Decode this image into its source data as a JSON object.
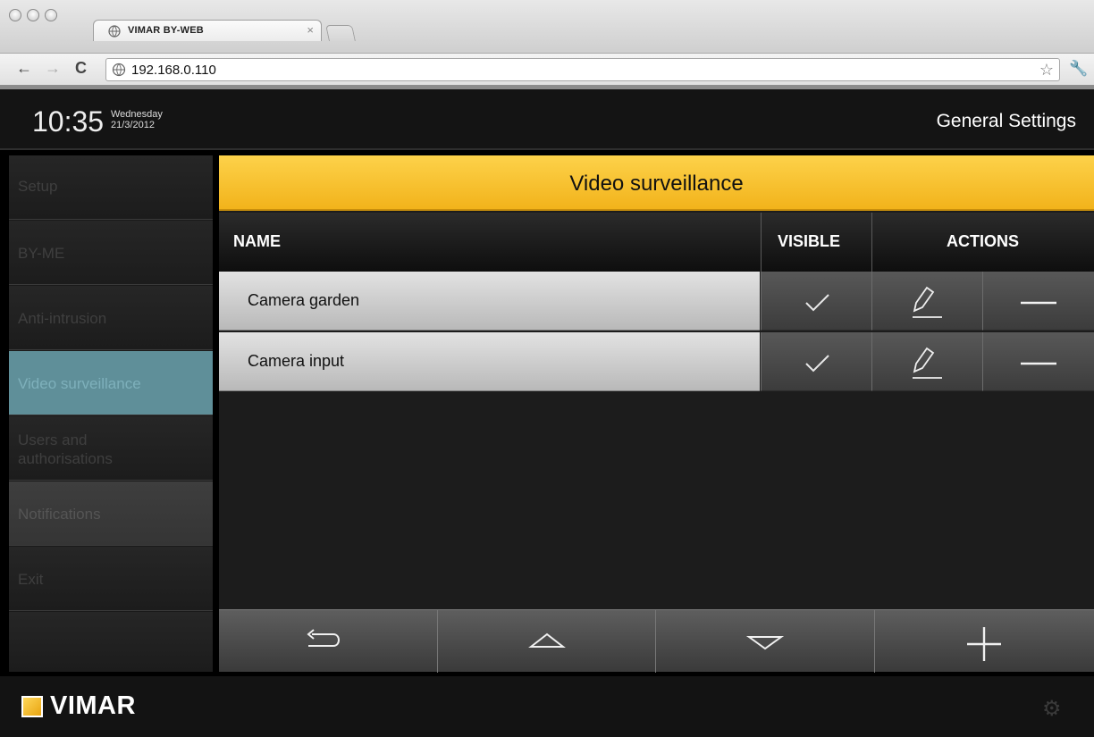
{
  "browser": {
    "tab_title": "VIMAR BY-WEB",
    "url": "192.168.0.110"
  },
  "header": {
    "time": "10:35",
    "weekday": "Wednesday",
    "date": "21/3/2012",
    "title": "General Settings"
  },
  "sidebar": {
    "items": [
      {
        "label": "Setup",
        "state": "normal"
      },
      {
        "label": "BY-ME",
        "state": "normal"
      },
      {
        "label": "Anti-intrusion",
        "state": "normal"
      },
      {
        "label": "Video surveillance",
        "state": "active"
      },
      {
        "label": "Users and authorisations",
        "state": "normal"
      },
      {
        "label": "Notifications",
        "state": "dim"
      },
      {
        "label": "Exit",
        "state": "normal"
      }
    ]
  },
  "main": {
    "section_title": "Video surveillance",
    "columns": {
      "name": "NAME",
      "visible": "VISIBLE",
      "actions": "ACTIONS"
    },
    "rows": [
      {
        "name": "Camera garden",
        "visible": true
      },
      {
        "name": "Camera input",
        "visible": true
      }
    ]
  },
  "bottom_buttons": [
    "back-arrow-icon",
    "up-arrow-icon",
    "down-arrow-icon",
    "plus-icon"
  ],
  "footer": {
    "brand": "VIMAR"
  },
  "colors": {
    "accent_yellow": "#f7c02e",
    "active_item": "#5f8f99"
  }
}
